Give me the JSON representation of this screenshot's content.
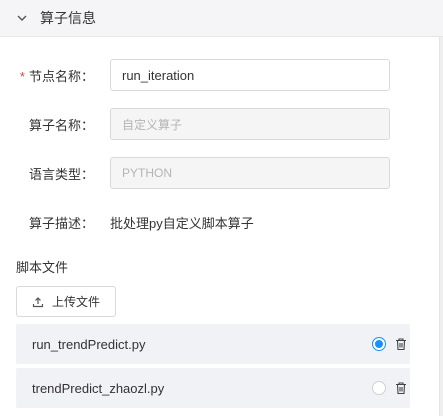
{
  "header": {
    "title": "算子信息",
    "toggle_icon": "chevron-down-icon"
  },
  "form": {
    "node_name": {
      "label": "节点名称：",
      "required_mark": "*",
      "value": "run_iteration"
    },
    "operator_name": {
      "label": "算子名称：",
      "value": "自定义算子"
    },
    "language_type": {
      "label": "语言类型：",
      "value": "PYTHON"
    },
    "operator_desc": {
      "label": "算子描述：",
      "value": "批处理py自定义脚本算子"
    }
  },
  "script": {
    "section_title": "脚本文件",
    "upload_label": "上传文件",
    "files": [
      {
        "name": "run_trendPredict.py",
        "selected": true
      },
      {
        "name": "trendPredict_zhaozl.py",
        "selected": false
      }
    ]
  },
  "colors": {
    "accent": "#1890ff",
    "required": "#e0463a",
    "header_bg": "#f5f5f7",
    "file_bg": "#f1f2f5"
  }
}
